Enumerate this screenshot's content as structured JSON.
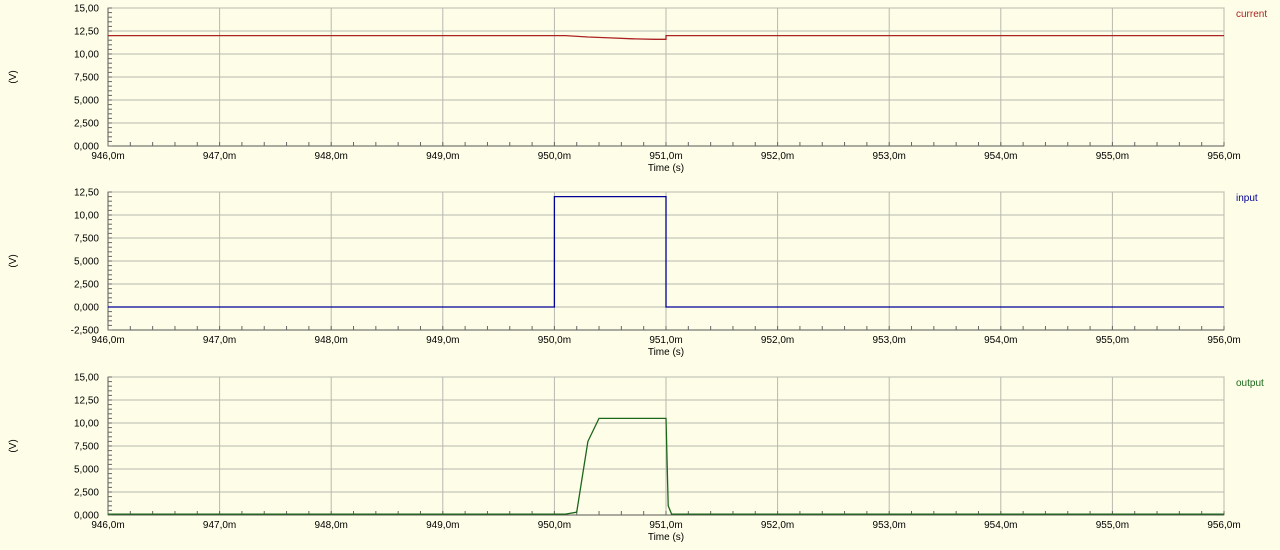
{
  "chart_data": [
    {
      "type": "line",
      "title": "",
      "xlabel": "Time (s)",
      "ylabel": "(V)",
      "xlim": [
        946.0,
        956.0
      ],
      "ylim": [
        0,
        15
      ],
      "x_ticks": [
        946,
        947,
        948,
        949,
        950,
        951,
        952,
        953,
        954,
        955,
        956
      ],
      "x_tick_labels": [
        "946,0m",
        "947,0m",
        "948,0m",
        "949,0m",
        "950,0m",
        "951,0m",
        "952,0m",
        "953,0m",
        "954,0m",
        "955,0m",
        "956,0m"
      ],
      "y_ticks": [
        0,
        2.5,
        5,
        7.5,
        10,
        12.5,
        15
      ],
      "y_tick_labels": [
        "0,000",
        "2,500",
        "5,000",
        "7,500",
        "10,00",
        "12,50",
        "15,00"
      ],
      "grid": true,
      "legend_position": "top-right",
      "series": [
        {
          "name": "current",
          "color": "#aa2222",
          "x": [
            946.0,
            950.1,
            950.3,
            950.5,
            950.7,
            950.9,
            951.0,
            951.0,
            956.0
          ],
          "y": [
            12.0,
            12.0,
            11.85,
            11.75,
            11.65,
            11.6,
            11.6,
            12.0,
            12.0
          ]
        }
      ]
    },
    {
      "type": "line",
      "title": "",
      "xlabel": "Time (s)",
      "ylabel": "(V)",
      "xlim": [
        946.0,
        956.0
      ],
      "ylim": [
        -2.5,
        12.5
      ],
      "x_ticks": [
        946,
        947,
        948,
        949,
        950,
        951,
        952,
        953,
        954,
        955,
        956
      ],
      "x_tick_labels": [
        "946,0m",
        "947,0m",
        "948,0m",
        "949,0m",
        "950,0m",
        "951,0m",
        "952,0m",
        "953,0m",
        "954,0m",
        "955,0m",
        "956,0m"
      ],
      "y_ticks": [
        -2.5,
        0,
        2.5,
        5,
        7.5,
        10,
        12.5
      ],
      "y_tick_labels": [
        "-2,500",
        "0,000",
        "2,500",
        "5,000",
        "7,500",
        "10,00",
        "12,50"
      ],
      "grid": true,
      "legend_position": "top-right",
      "series": [
        {
          "name": "input",
          "color": "#000099",
          "x": [
            946.0,
            950.0,
            950.0,
            951.0,
            951.0,
            956.0
          ],
          "y": [
            0,
            0,
            12.0,
            12.0,
            0,
            0
          ]
        }
      ]
    },
    {
      "type": "line",
      "title": "",
      "xlabel": "Time (s)",
      "ylabel": "(V)",
      "xlim": [
        946.0,
        956.0
      ],
      "ylim": [
        0,
        15
      ],
      "x_ticks": [
        946,
        947,
        948,
        949,
        950,
        951,
        952,
        953,
        954,
        955,
        956
      ],
      "x_tick_labels": [
        "946,0m",
        "947,0m",
        "948,0m",
        "949,0m",
        "950,0m",
        "951,0m",
        "952,0m",
        "953,0m",
        "954,0m",
        "955,0m",
        "956,0m"
      ],
      "y_ticks": [
        0,
        2.5,
        5,
        7.5,
        10,
        12.5,
        15
      ],
      "y_tick_labels": [
        "0,000",
        "2,500",
        "5,000",
        "7,500",
        "10,00",
        "12,50",
        "15,00"
      ],
      "grid": true,
      "legend_position": "top-right",
      "series": [
        {
          "name": "output",
          "color": "#1a661a",
          "x": [
            946.0,
            950.1,
            950.2,
            950.3,
            950.4,
            950.5,
            950.7,
            950.9,
            951.0,
            951.02,
            951.05,
            956.0
          ],
          "y": [
            0.1,
            0.1,
            0.3,
            8.0,
            10.5,
            10.5,
            10.5,
            10.5,
            10.5,
            1.0,
            0.1,
            0.1
          ]
        }
      ]
    }
  ]
}
